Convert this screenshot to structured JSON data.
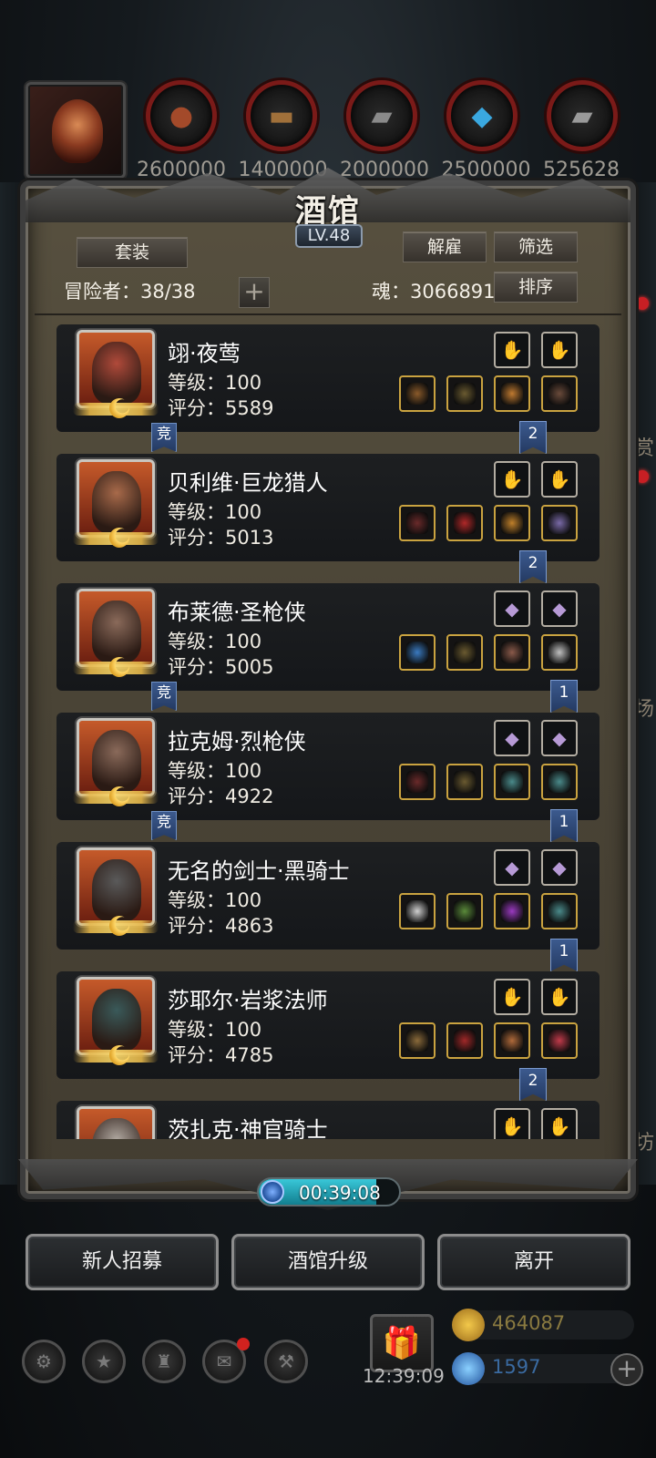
{
  "top": {
    "resources": [
      {
        "icon": "ore-icon",
        "value": "2600000",
        "color": "#a34a2a"
      },
      {
        "icon": "wood-icon",
        "value": "1400000",
        "color": "#a0703a"
      },
      {
        "icon": "stone-icon",
        "value": "2000000",
        "color": "#8a8a8a"
      },
      {
        "icon": "crystal-icon",
        "value": "2500000",
        "color": "#3aa8e0"
      },
      {
        "icon": "iron-icon",
        "value": "525628",
        "color": "#9a9a9a"
      }
    ]
  },
  "tavern": {
    "title": "酒馆",
    "level": "LV.48",
    "set_label": "套装",
    "dismiss_label": "解雇",
    "filter_label": "筛选",
    "sort_label": "排序",
    "adventurers_label": "冒险者：38/38",
    "soul_label": "魂：3066891",
    "plus_symbol": "+"
  },
  "heroes": [
    {
      "name": "翊·夜莺",
      "level": "等级：100",
      "score": "评分：5589",
      "skin": "#b04a3a",
      "tag": "竞",
      "tag_num": "2",
      "top_slots": [
        "glove",
        "glove"
      ],
      "equip": [
        "#8a5a2a",
        "#6a5a30",
        "#c07a30",
        "#6a4a3a"
      ]
    },
    {
      "name": "贝利维·巨龙猎人",
      "level": "等级：100",
      "score": "评分：5013",
      "skin": "#a86a4a",
      "tag": "",
      "tag_num": "2",
      "top_slots": [
        "glove",
        "glove"
      ],
      "equip": [
        "#6a2a2a",
        "#b02828",
        "#c0802a",
        "#7a6aa8"
      ]
    },
    {
      "name": "布莱德·圣枪侠",
      "level": "等级：100",
      "score": "评分：5005",
      "skin": "#8a6a5a",
      "tag": "竞",
      "tag_num": "1",
      "top_slots": [
        "crystal",
        "crystal"
      ],
      "equip": [
        "#3a7ac0",
        "#6a5a30",
        "#8a5a4a",
        "#c0c0c0"
      ]
    },
    {
      "name": "拉克姆·烈枪侠",
      "level": "等级：100",
      "score": "评分：4922",
      "skin": "#8a6a5a",
      "tag": "竞",
      "tag_num": "1",
      "top_slots": [
        "crystal",
        "crystal"
      ],
      "equip": [
        "#6a2a2a",
        "#6a5a30",
        "#4a8a8a",
        "#4a8a8a"
      ]
    },
    {
      "name": "无名的剑士·黑骑士",
      "level": "等级：100",
      "score": "评分：4863",
      "skin": "#5a5a5a",
      "tag": "",
      "tag_num": "1",
      "top_slots": [
        "crystal",
        "crystal"
      ],
      "equip": [
        "#d0d0d0",
        "#5a8a3a",
        "#9a3ac0",
        "#4a8a8a"
      ]
    },
    {
      "name": "莎耶尔·岩浆法师",
      "level": "等级：100",
      "score": "评分：4785",
      "skin": "#3a5a5a",
      "tag": "",
      "tag_num": "2",
      "top_slots": [
        "glove",
        "glove"
      ],
      "equip": [
        "#8a6a3a",
        "#a02828",
        "#b06a3a",
        "#c03a4a"
      ]
    },
    {
      "name": "茨扎克·神官骑士",
      "level": "",
      "score": "",
      "skin": "#b0a8a0",
      "tag": "",
      "tag_num": "",
      "top_slots": [
        "glove",
        "glove"
      ],
      "equip": []
    }
  ],
  "bottom": {
    "timer": "00:39:08",
    "timer_progress": 0.84,
    "recruit_label": "新人招募",
    "upgrade_label": "酒馆升级",
    "leave_label": "离开"
  },
  "hud": {
    "clock": "12:39:09",
    "gold": "464087",
    "gems": "1597",
    "gold_color": "#8a7a40",
    "gem_color": "#3a6aa0",
    "edge_text_1": "赏",
    "edge_text_2": "技场",
    "edge_text_3": "工坊"
  }
}
